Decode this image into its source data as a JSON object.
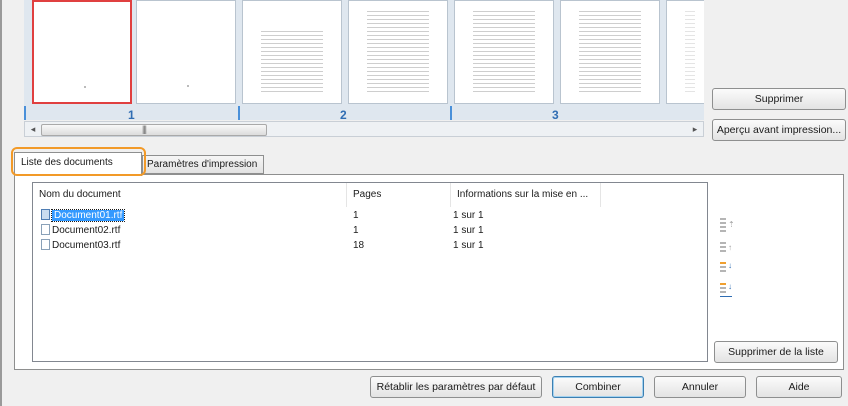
{
  "preview": {
    "page_numbers": [
      "1",
      "2",
      "3"
    ],
    "delete_button": "Supprimer",
    "print_preview_button": "Aperçu avant impression..."
  },
  "tabs": {
    "documents": "Liste des documents",
    "print_settings": "Paramètres d'impression"
  },
  "documents": {
    "columns": [
      "Nom du document",
      "Pages",
      "Informations sur la mise en ..."
    ],
    "rows": [
      {
        "name": "Document01.rtf",
        "pages": "1",
        "info": "1 sur 1"
      },
      {
        "name": "Document02.rtf",
        "pages": "1",
        "info": "1 sur 1"
      },
      {
        "name": "Document03.rtf",
        "pages": "18",
        "info": "1 sur 1"
      }
    ],
    "selected_row": 0
  },
  "side_actions": {
    "remove_from_list": "Supprimer de la liste",
    "order_icons": [
      "move-top-icon",
      "move-up-icon",
      "move-down-icon",
      "move-bottom-icon"
    ]
  },
  "footer": {
    "restore_defaults": "Rétablir les paramètres par défaut",
    "combine": "Combiner",
    "cancel": "Annuler",
    "help": "Aide"
  },
  "colors": {
    "highlight": "#f29a28",
    "selection": "#3399ff",
    "accent": "#2f6db3"
  }
}
